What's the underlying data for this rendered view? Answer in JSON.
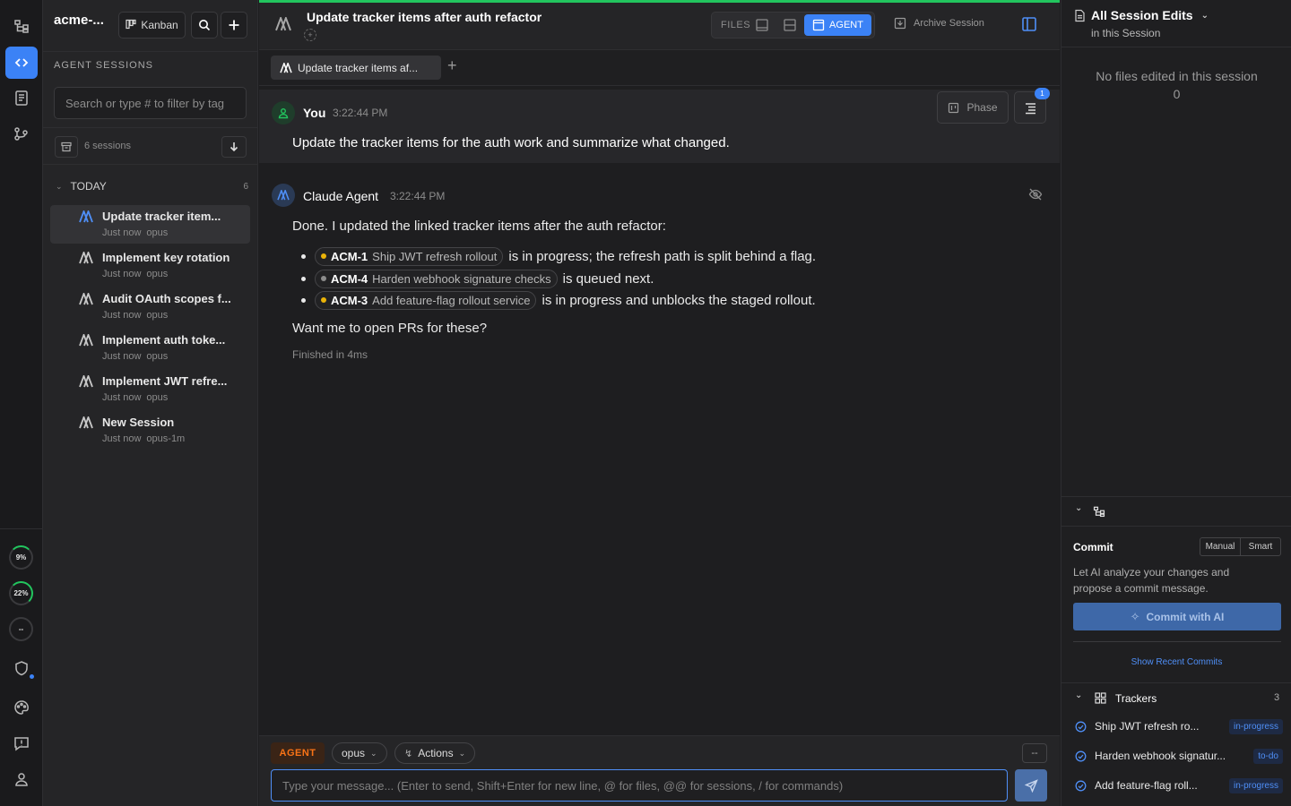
{
  "rail": {
    "icons": [
      "workflow-icon",
      "code-icon",
      "clipboard-icon",
      "git-branch-icon"
    ],
    "usage": [
      {
        "label": "9%",
        "level": 0.09
      },
      {
        "label": "22%",
        "level": 0.22
      },
      {
        "label": "--",
        "level": 0
      }
    ]
  },
  "sidebar": {
    "project": "acme-...",
    "kanban_label": "Kanban",
    "section_label": "AGENT SESSIONS",
    "search_placeholder": "Search or type # to filter by tag",
    "session_count": "6 sessions",
    "group": {
      "label": "TODAY",
      "count": "6"
    },
    "sessions": [
      {
        "title": "Update tracker item...",
        "time": "Just now",
        "model": "opus"
      },
      {
        "title": "Implement key rotation",
        "time": "Just now",
        "model": "opus"
      },
      {
        "title": "Audit OAuth scopes f...",
        "time": "Just now",
        "model": "opus"
      },
      {
        "title": "Implement auth toke...",
        "time": "Just now",
        "model": "opus"
      },
      {
        "title": "Implement JWT refre...",
        "time": "Just now",
        "model": "opus"
      },
      {
        "title": "New Session",
        "time": "Just now",
        "model": "opus-1m"
      }
    ]
  },
  "main": {
    "title": "Update tracker items after auth refactor",
    "view_files": "FILES",
    "view_agent": "AGENT",
    "archive_label": "Archive Session",
    "tab_label": "Update tracker items af...",
    "user": {
      "name": "You",
      "time": "3:22:44 PM",
      "message": "Update the tracker items for the auth work and summarize what changed."
    },
    "phase_label": "Phase",
    "list_badge": "1",
    "agent": {
      "name": "Claude Agent",
      "time": "3:22:44 PM",
      "intro": "Done. I updated the linked tracker items after the auth refactor:",
      "items": [
        {
          "id": "ACM-1",
          "title": "Ship JWT refresh rollout",
          "text": "is in progress; the refresh path is split behind a flag.",
          "dot": "#eab308"
        },
        {
          "id": "ACM-4",
          "title": "Harden webhook signature checks",
          "text": "is queued next.",
          "dot": "#8c8c8c"
        },
        {
          "id": "ACM-3",
          "title": "Add feature-flag rollout service",
          "text": "is in progress and unblocks the staged rollout.",
          "dot": "#eab308"
        }
      ],
      "question": "Want me to open PRs for these?",
      "footer": "Finished in 4ms"
    },
    "composer": {
      "mode": "AGENT",
      "model": "opus",
      "actions": "Actions",
      "dash": "--",
      "placeholder": "Type your message... (Enter to send, Shift+Enter for new line, @ for files, @@ for sessions, / for commands)"
    }
  },
  "right": {
    "title": "All Session Edits",
    "subtitle": "in this Session",
    "empty_text": "No files edited in this session",
    "empty_count": "0",
    "commit": {
      "label": "Commit",
      "mode_manual": "Manual",
      "mode_smart": "Smart",
      "desc": "Let AI analyze your changes and propose a commit message.",
      "button": "Commit with AI",
      "recent": "Show Recent Commits"
    },
    "trackers": {
      "label": "Trackers",
      "count": "3",
      "items": [
        {
          "title": "Ship JWT refresh ro...",
          "status": "in-progress"
        },
        {
          "title": "Harden webhook signatur...",
          "status": "to-do"
        },
        {
          "title": "Add feature-flag roll...",
          "status": "in-progress"
        }
      ]
    }
  },
  "colors": {
    "accent": "#3b82f6",
    "progress_green": "#22c55e",
    "agent_orange": "#f97316",
    "status_yellow": "#eab308"
  }
}
